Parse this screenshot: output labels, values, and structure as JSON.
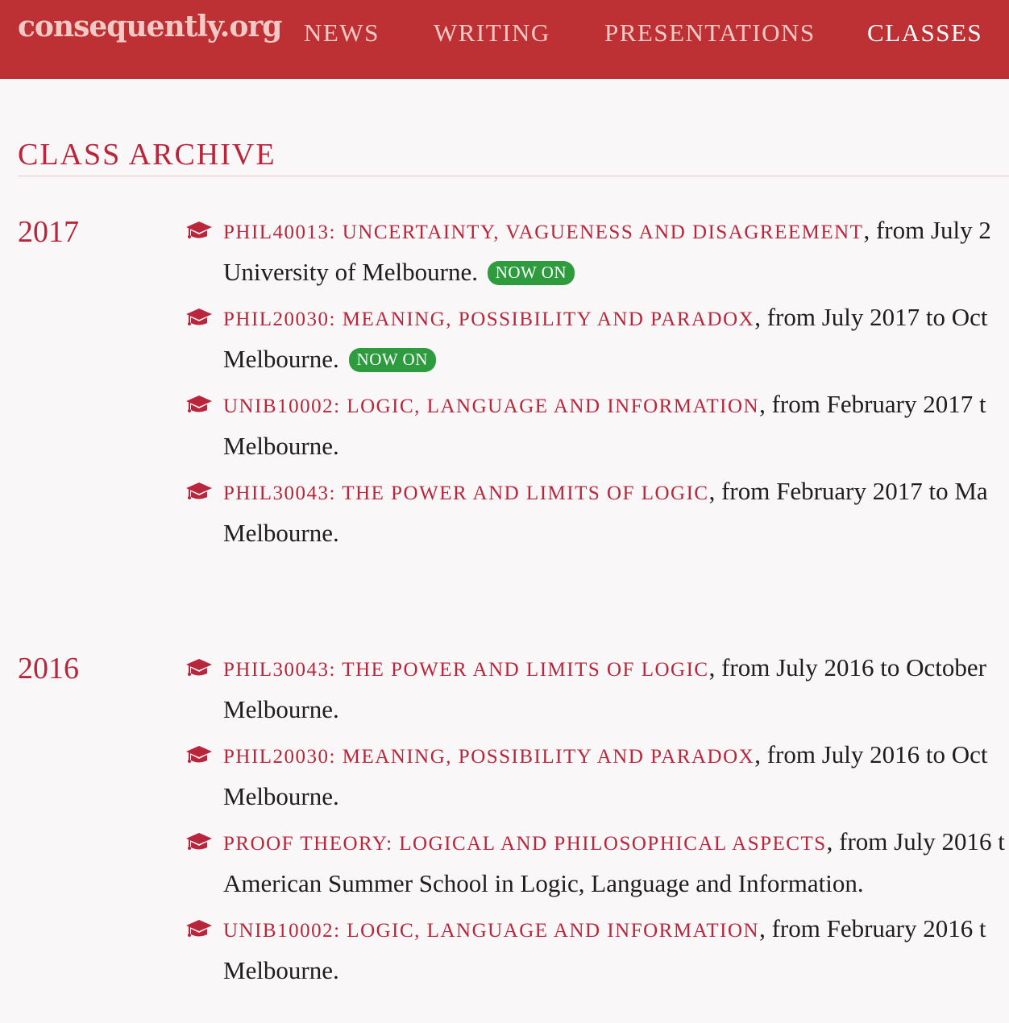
{
  "nav": {
    "brand": "consequently.org",
    "links": [
      "NEWS",
      "WRITING",
      "PRESENTATIONS",
      "CLASSES"
    ],
    "active": "CLASSES"
  },
  "page": {
    "title": "CLASS ARCHIVE"
  },
  "colors": {
    "navbar_bg": "#bd3135",
    "accent": "#b9253b",
    "badge_bg": "#2e9b3f",
    "page_bg": "#f9f7f8"
  },
  "icons": {
    "course": "graduation-cap-icon"
  },
  "years": [
    {
      "year": "2017",
      "classes": [
        {
          "title": "PHIL40013: UNCERTAINTY, VAGUENESS AND DISAGREEMENT",
          "detail_line1": ", from July 2",
          "detail_line2": "University of Melbourne.",
          "badge": "NOW ON"
        },
        {
          "title": "PHIL20030: MEANING, POSSIBILITY AND PARADOX",
          "detail_line1": ", from July 2017 to Oct",
          "detail_line2": "Melbourne.",
          "badge": "NOW ON"
        },
        {
          "title": "UNIB10002: LOGIC, LANGUAGE AND INFORMATION",
          "detail_line1": ", from February 2017 t",
          "detail_line2": "Melbourne.",
          "badge": ""
        },
        {
          "title": "PHIL30043: THE POWER AND LIMITS OF LOGIC",
          "detail_line1": ", from February 2017 to Ma",
          "detail_line2": "Melbourne.",
          "badge": ""
        }
      ]
    },
    {
      "year": "2016",
      "classes": [
        {
          "title": "PHIL30043: THE POWER AND LIMITS OF LOGIC",
          "detail_line1": ", from July 2016 to October",
          "detail_line2": "Melbourne.",
          "badge": ""
        },
        {
          "title": "PHIL20030: MEANING, POSSIBILITY AND PARADOX",
          "detail_line1": ", from July 2016 to Oct",
          "detail_line2": "Melbourne.",
          "badge": ""
        },
        {
          "title": "PROOF THEORY: LOGICAL AND PHILOSOPHICAL ASPECTS",
          "detail_line1": ", from July 2016 t",
          "detail_line2": "American Summer School in Logic, Language and Information.",
          "badge": ""
        },
        {
          "title": "UNIB10002: LOGIC, LANGUAGE AND INFORMATION",
          "detail_line1": ", from February 2016 t",
          "detail_line2": "Melbourne.",
          "badge": ""
        }
      ]
    }
  ]
}
